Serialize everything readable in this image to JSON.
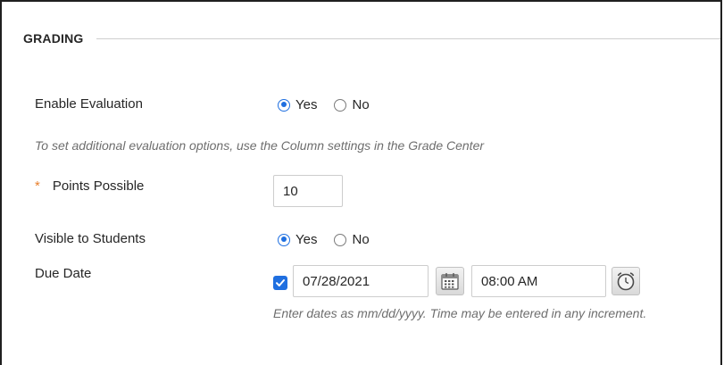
{
  "section": {
    "title": "GRADING"
  },
  "enable_evaluation": {
    "label": "Enable Evaluation",
    "options": [
      {
        "label": "Yes",
        "checked": true
      },
      {
        "label": "No",
        "checked": false
      }
    ],
    "hint": "To set additional evaluation options, use the Column settings in the Grade Center"
  },
  "points_possible": {
    "required_marker": "*",
    "label": "Points Possible",
    "value": "10"
  },
  "visible_to_students": {
    "label": "Visible to Students",
    "options": [
      {
        "label": "Yes",
        "checked": true
      },
      {
        "label": "No",
        "checked": false
      }
    ]
  },
  "due_date": {
    "label": "Due Date",
    "enabled": true,
    "date_value": "07/28/2021",
    "time_value": "08:00 AM",
    "calendar_icon": "calendar-icon",
    "clock_icon": "clock-icon",
    "hint": "Enter dates as mm/dd/yyyy. Time may be entered in any increment."
  },
  "colors": {
    "accent": "#1f6fe0",
    "required": "#e8802f",
    "hint_text": "#6e6e6e"
  }
}
